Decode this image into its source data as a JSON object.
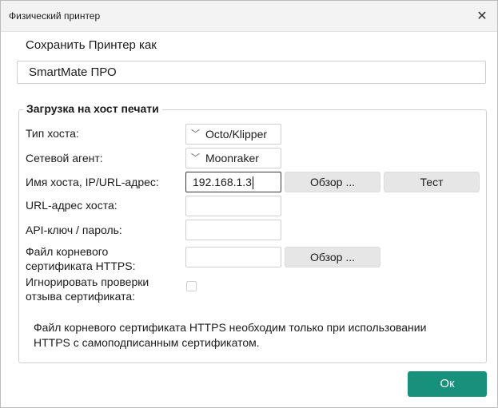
{
  "window": {
    "title": "Физический принтер",
    "close_glyph": "✕"
  },
  "save_as": {
    "label": "Сохранить Принтер как",
    "value": "SmartMate ПРО"
  },
  "group": {
    "title": "Загрузка на хост печати",
    "host_type": {
      "label": "Тип хоста:",
      "value": "Octo/Klipper"
    },
    "network_agent": {
      "label": "Сетевой агент:",
      "value": "Moonraker"
    },
    "hostname": {
      "label": "Имя хоста, IP/URL-адрес:",
      "value": "192.168.1.3"
    },
    "host_url": {
      "label": "URL-адрес хоста:",
      "value": ""
    },
    "api_key": {
      "label": "API-ключ / пароль:",
      "value": ""
    },
    "https_cert": {
      "label_line1": "Файл корневого",
      "label_line2": "сертификата HTTPS:",
      "value": ""
    },
    "ignore_revocation": {
      "label_line1": "Игнорировать проверки",
      "label_line2": "отзыва сертификата:",
      "checked": false
    },
    "browse_label": "Обзор ...",
    "test_label": "Тест",
    "note_line1": "Файл корневого сертификата HTTPS необходим только при использовании",
    "note_line2": "HTTPS с самоподписанным сертификатом."
  },
  "ok_label": "Ок",
  "colors": {
    "accent": "#17917b"
  },
  "icons": {
    "dropdown": "chevron-down-icon",
    "close": "close-icon"
  }
}
